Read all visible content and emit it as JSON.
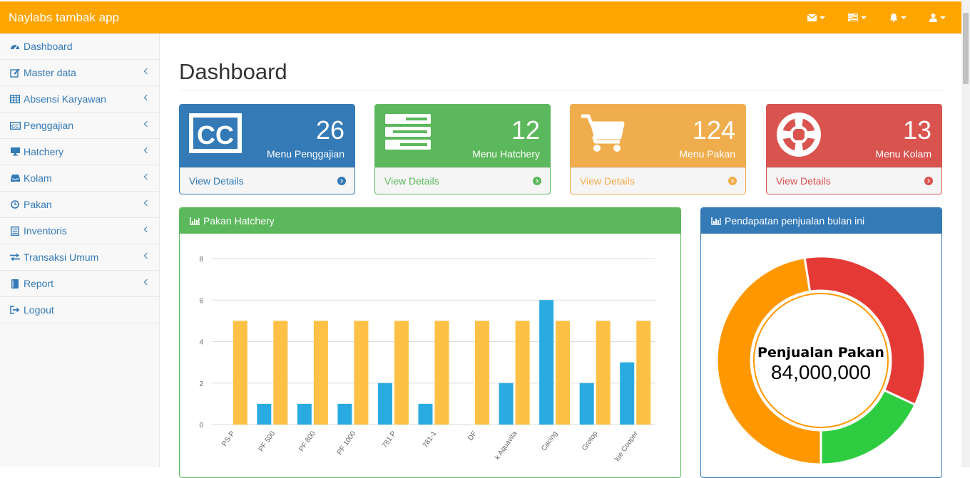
{
  "app": {
    "title": "Naylabs tambak app"
  },
  "topbar": {
    "icons": [
      "envelope-icon",
      "tasks-icon",
      "bell-icon",
      "user-icon"
    ]
  },
  "sidebar": {
    "items": [
      {
        "label": "Dashboard",
        "icon": "dashboard-icon",
        "chevron": false
      },
      {
        "label": "Master data",
        "icon": "edit-icon",
        "chevron": true
      },
      {
        "label": "Absensi Karyawan",
        "icon": "table-icon",
        "chevron": true
      },
      {
        "label": "Penggajian",
        "icon": "cc-icon",
        "chevron": true
      },
      {
        "label": "Hatchery",
        "icon": "desktop-icon",
        "chevron": true
      },
      {
        "label": "Kolam",
        "icon": "inbox-icon",
        "chevron": true
      },
      {
        "label": "Pakan",
        "icon": "clock-icon",
        "chevron": true
      },
      {
        "label": "Inventoris",
        "icon": "list-icon",
        "chevron": true
      },
      {
        "label": "Transaksi Umum",
        "icon": "exchange-icon",
        "chevron": true
      },
      {
        "label": "Report",
        "icon": "book-icon",
        "chevron": true
      },
      {
        "label": "Logout",
        "icon": "sign-out-icon",
        "chevron": false
      }
    ]
  },
  "page": {
    "title": "Dashboard"
  },
  "cards": [
    {
      "count": "26",
      "label": "Menu Penggajian",
      "link": "View Details",
      "icon": "cc-icon",
      "color": "#337ab7"
    },
    {
      "count": "12",
      "label": "Menu Hatchery",
      "link": "View Details",
      "icon": "server-icon",
      "color": "#5cb85c"
    },
    {
      "count": "124",
      "label": "Menu Pakan",
      "link": "View Details",
      "icon": "cart-icon",
      "color": "#f0ad4e"
    },
    {
      "count": "13",
      "label": "Menu Kolam",
      "link": "View Details",
      "icon": "life-ring-icon",
      "color": "#d9534f"
    }
  ],
  "panels": {
    "hatchery": {
      "title": "Pakan Hatchery",
      "color": "#5cb85c"
    },
    "income": {
      "title": "Pendapatan penjualan bulan ini",
      "color": "#337ab7"
    }
  },
  "chart_data": [
    {
      "type": "bar",
      "categories": [
        "PS-P",
        "PF 500",
        "PF 800",
        "PF 1000",
        "781 P",
        "781-1",
        "DF",
        "k Aquavita",
        "Cacing",
        "Grotop",
        "lue Cooper"
      ],
      "series": [
        {
          "values": [
            0,
            1,
            1,
            1,
            2,
            1,
            0,
            2,
            6,
            2,
            3
          ],
          "color": "#29abe2"
        },
        {
          "values": [
            5,
            5,
            5,
            5,
            5,
            5,
            5,
            5,
            5,
            5,
            5
          ],
          "color": "#ffc145"
        }
      ],
      "ylim": [
        0,
        8
      ],
      "yticks": [
        0,
        2,
        4,
        6,
        8
      ],
      "grid": true
    },
    {
      "type": "pie",
      "donut": true,
      "center_title": "Penjualan Pakan",
      "center_value": "84,000,000",
      "slices": [
        {
          "value": 0.475,
          "color": "#ff9800"
        },
        {
          "value": 0.345,
          "color": "#e53935"
        },
        {
          "value": 0.18,
          "color": "#2ecc40"
        }
      ]
    }
  ]
}
